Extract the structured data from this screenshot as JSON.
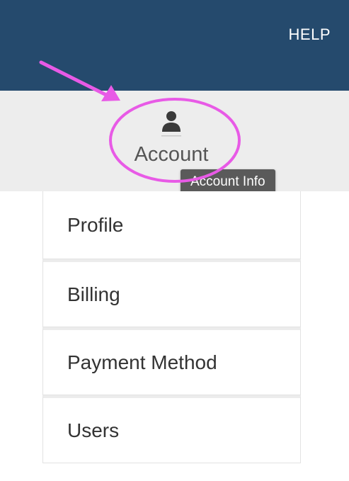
{
  "header": {
    "help_label": "HELP",
    "background": "#254a6d"
  },
  "account": {
    "icon": "user-icon",
    "label": "Account",
    "tooltip": "Account Info"
  },
  "menu": {
    "items": [
      {
        "label": "Profile"
      },
      {
        "label": "Billing"
      },
      {
        "label": "Payment Method"
      },
      {
        "label": "Users"
      }
    ]
  },
  "annotation": {
    "color": "#e85ae6",
    "shapes": [
      "arrow",
      "ellipse"
    ]
  }
}
